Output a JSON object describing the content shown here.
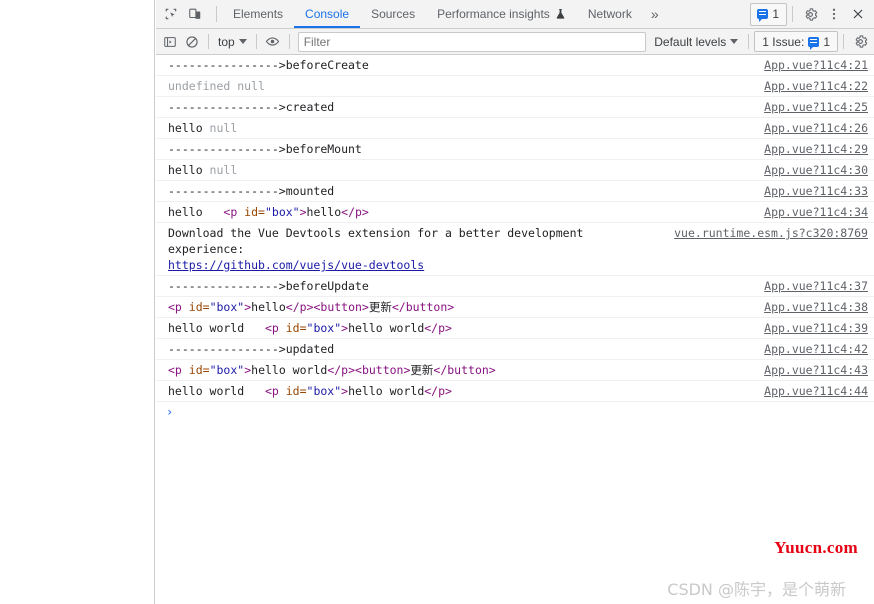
{
  "tabbar": {
    "icons": [
      {
        "name": "inspect-element-icon",
        "label": "Inspect element"
      },
      {
        "name": "device-toolbar-icon",
        "label": "Toggle device toolbar"
      }
    ],
    "tabs": [
      {
        "label": "Elements",
        "active": false,
        "warning": false
      },
      {
        "label": "Console",
        "active": true,
        "warning": false
      },
      {
        "label": "Sources",
        "active": false,
        "warning": false
      },
      {
        "label": "Performance insights",
        "active": false,
        "warning": true
      },
      {
        "label": "Network",
        "active": false,
        "warning": false
      }
    ],
    "more_label": "»",
    "message_badge": {
      "count": "1",
      "icon": "speech-bubble-icon",
      "color": "#1a73e8"
    },
    "settings_label": "gear-icon",
    "more_options_label": "kebab-menu-icon",
    "close_label": "close-icon"
  },
  "filterbar": {
    "sidebar_toggle": "console-sidebar-icon",
    "clear_console": "clear-console-icon",
    "context": {
      "value": "top"
    },
    "eye_icon": "live-expression-eye-icon",
    "filter": {
      "value": "",
      "placeholder": "Filter"
    },
    "levels": {
      "value": "Default levels"
    },
    "issues": {
      "label": "1 Issue:",
      "count": "1"
    },
    "settings": "gear-icon"
  },
  "console": {
    "rows": [
      {
        "tokens": [
          {
            "t": "---------------->beforeCreate",
            "c": "t-plain"
          }
        ],
        "source": "App.vue?11c4:21"
      },
      {
        "tokens": [
          {
            "t": "undefined null",
            "c": "t-dim"
          }
        ],
        "source": "App.vue?11c4:22"
      },
      {
        "tokens": [
          {
            "t": "---------------->created",
            "c": "t-plain"
          }
        ],
        "source": "App.vue?11c4:25"
      },
      {
        "tokens": [
          {
            "t": "hello ",
            "c": "t-plain"
          },
          {
            "t": "null",
            "c": "t-dim"
          }
        ],
        "source": "App.vue?11c4:26"
      },
      {
        "tokens": [
          {
            "t": "---------------->beforeMount",
            "c": "t-plain"
          }
        ],
        "source": "App.vue?11c4:29"
      },
      {
        "tokens": [
          {
            "t": "hello ",
            "c": "t-plain"
          },
          {
            "t": "null",
            "c": "t-dim"
          }
        ],
        "source": "App.vue?11c4:30"
      },
      {
        "tokens": [
          {
            "t": "---------------->mounted",
            "c": "t-plain"
          }
        ],
        "source": "App.vue?11c4:33"
      },
      {
        "tokens": [
          {
            "t": "hello   ",
            "c": "t-plain"
          },
          {
            "t": "<p",
            "c": "t-tag"
          },
          {
            "t": " id",
            "c": "t-attr"
          },
          {
            "t": "=",
            "c": "t-attr"
          },
          {
            "t": "\"box\"",
            "c": "t-val"
          },
          {
            "t": ">",
            "c": "t-tag"
          },
          {
            "t": "hello",
            "c": "t-txt"
          },
          {
            "t": "</p>",
            "c": "t-tag"
          }
        ],
        "source": "App.vue?11c4:34"
      },
      {
        "tokens": [
          {
            "t": "Download the Vue Devtools extension for a better development experience: ",
            "c": "t-plain"
          },
          {
            "t": "\nhttps://github.com/vuejs/vue-devtools",
            "c": "t-link"
          }
        ],
        "source": "vue.runtime.esm.js?c320:8769",
        "tall": true
      },
      {
        "tokens": [
          {
            "t": "---------------->beforeUpdate",
            "c": "t-plain"
          }
        ],
        "source": "App.vue?11c4:37"
      },
      {
        "tokens": [
          {
            "t": "<p",
            "c": "t-tag"
          },
          {
            "t": " id",
            "c": "t-attr"
          },
          {
            "t": "=",
            "c": "t-attr"
          },
          {
            "t": "\"box\"",
            "c": "t-val"
          },
          {
            "t": ">",
            "c": "t-tag"
          },
          {
            "t": "hello",
            "c": "t-txt"
          },
          {
            "t": "</p>",
            "c": "t-tag"
          },
          {
            "t": "<button>",
            "c": "t-tag"
          },
          {
            "t": "更新",
            "c": "t-txt"
          },
          {
            "t": "</button>",
            "c": "t-tag"
          }
        ],
        "source": "App.vue?11c4:38"
      },
      {
        "tokens": [
          {
            "t": "hello world   ",
            "c": "t-plain"
          },
          {
            "t": "<p",
            "c": "t-tag"
          },
          {
            "t": " id",
            "c": "t-attr"
          },
          {
            "t": "=",
            "c": "t-attr"
          },
          {
            "t": "\"box\"",
            "c": "t-val"
          },
          {
            "t": ">",
            "c": "t-tag"
          },
          {
            "t": "hello world",
            "c": "t-txt"
          },
          {
            "t": "</p>",
            "c": "t-tag"
          }
        ],
        "source": "App.vue?11c4:39"
      },
      {
        "tokens": [
          {
            "t": "---------------->updated",
            "c": "t-plain"
          }
        ],
        "source": "App.vue?11c4:42"
      },
      {
        "tokens": [
          {
            "t": "<p",
            "c": "t-tag"
          },
          {
            "t": " id",
            "c": "t-attr"
          },
          {
            "t": "=",
            "c": "t-attr"
          },
          {
            "t": "\"box\"",
            "c": "t-val"
          },
          {
            "t": ">",
            "c": "t-tag"
          },
          {
            "t": "hello world",
            "c": "t-txt"
          },
          {
            "t": "</p>",
            "c": "t-tag"
          },
          {
            "t": "<button>",
            "c": "t-tag"
          },
          {
            "t": "更新",
            "c": "t-txt"
          },
          {
            "t": "</button>",
            "c": "t-tag"
          }
        ],
        "source": "App.vue?11c4:43"
      },
      {
        "tokens": [
          {
            "t": "hello world   ",
            "c": "t-plain"
          },
          {
            "t": "<p",
            "c": "t-tag"
          },
          {
            "t": " id",
            "c": "t-attr"
          },
          {
            "t": "=",
            "c": "t-attr"
          },
          {
            "t": "\"box\"",
            "c": "t-val"
          },
          {
            "t": ">",
            "c": "t-tag"
          },
          {
            "t": "hello world",
            "c": "t-txt"
          },
          {
            "t": "</p>",
            "c": "t-tag"
          }
        ],
        "source": "App.vue?11c4:44"
      }
    ],
    "prompt": {
      "caret": "›",
      "value": ""
    }
  },
  "watermarks": {
    "yuucn": "Yuucn.com",
    "csdn": "CSDN @陈宇，是个萌新"
  }
}
